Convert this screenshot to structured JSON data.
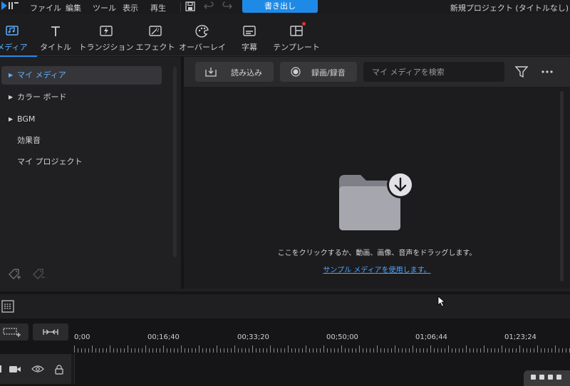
{
  "menubar": {
    "items": [
      "ファイル",
      "編集",
      "ツール",
      "表示",
      "再生"
    ],
    "export_label": "書き出し",
    "project_title": "新規プロジェクト (タイトルなし)"
  },
  "rooms": [
    {
      "label": "メディア",
      "icon": "media-icon",
      "active": true
    },
    {
      "label": "タイトル",
      "icon": "title-icon"
    },
    {
      "label": "トランジション",
      "icon": "transition-icon"
    },
    {
      "label": "エフェクト",
      "icon": "effect-icon"
    },
    {
      "label": "オーバーレイ",
      "icon": "overlay-icon"
    },
    {
      "label": "字幕",
      "icon": "subtitle-icon"
    },
    {
      "label": "テンプレート",
      "icon": "template-icon",
      "badge": true
    }
  ],
  "library": {
    "tree": [
      {
        "label": "マイ メディア",
        "expandable": true,
        "selected": true
      },
      {
        "label": "カラー ボード",
        "expandable": true
      },
      {
        "label": "BGM",
        "expandable": true
      },
      {
        "label": "効果音"
      },
      {
        "label": "マイ プロジェクト"
      }
    ],
    "import_label": "読み込み",
    "record_label": "録画/録音",
    "search_placeholder": "マイ メディアを検索",
    "drop_hint": "ここをクリックするか、動画、画像、音声をドラッグします。",
    "sample_link": "サンプル メディアを使用します。"
  },
  "timeline": {
    "ruler_labels": [
      "0;00",
      "00;16;40",
      "00;33;20",
      "00;50;00",
      "01;06;44",
      "01;23;24"
    ]
  },
  "colors": {
    "accent": "#1f8ae6",
    "active_text": "#5fb0ff",
    "link": "#4ea6ff",
    "badge": "#e2322f"
  }
}
